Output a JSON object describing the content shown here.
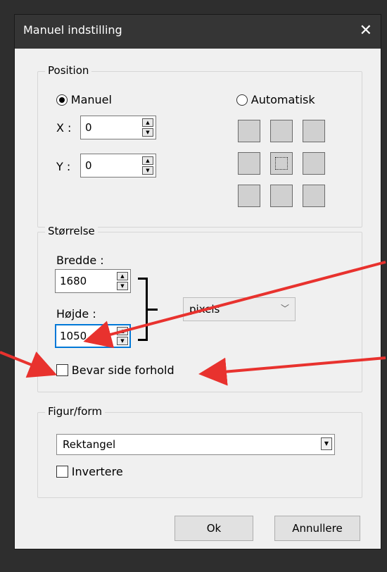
{
  "dialog": {
    "title": "Manuel indstilling",
    "close_icon": "close-icon"
  },
  "position": {
    "legend": "Position",
    "manual_label": "Manuel",
    "manual_selected": true,
    "automatic_label": "Automatisk",
    "automatic_selected": false,
    "x_label": "X :",
    "x_value": "0",
    "y_label": "Y :",
    "y_value": "0",
    "anchor_grid_selected": "center"
  },
  "size": {
    "legend": "Størrelse",
    "width_label": "Bredde :",
    "width_value": "1680",
    "height_label": "Højde :",
    "height_value": "1050",
    "unit": "pixels",
    "keep_ratio_label": "Bevar side forhold",
    "keep_ratio_checked": false
  },
  "shape": {
    "legend": "Figur/form",
    "selected": "Rektangel",
    "invert_label": "Invertere",
    "invert_checked": false
  },
  "buttons": {
    "ok": "Ok",
    "cancel": "Annullere"
  },
  "annotation_color": "#e8322e"
}
